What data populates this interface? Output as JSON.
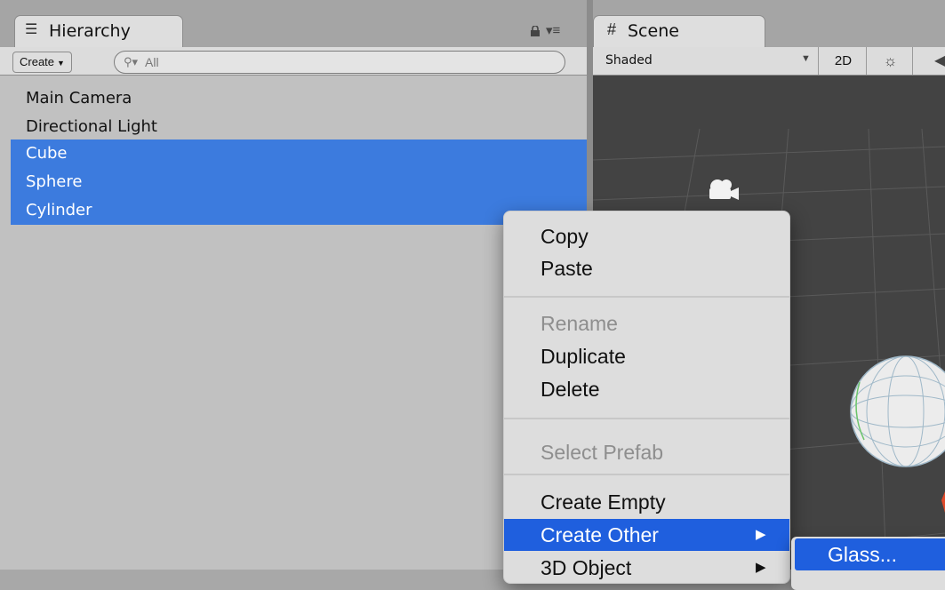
{
  "hierarchy": {
    "tab_label": "Hierarchy",
    "tab_icon": "list-icon",
    "lock_icon": "lock-icon",
    "menu_icon": "panel-menu-icon",
    "menu_glyph": "▾≡",
    "create_label": "Create",
    "search_placeholder": "All",
    "items": [
      {
        "label": "Main Camera",
        "selected": false
      },
      {
        "label": "Directional Light",
        "selected": false
      },
      {
        "label": "Cube",
        "selected": true
      },
      {
        "label": "Sphere",
        "selected": true
      },
      {
        "label": "Cylinder",
        "selected": true
      }
    ],
    "selection_color": "#3c7bde"
  },
  "scene": {
    "tab_label": "Scene",
    "tab_icon": "grid-icon",
    "shading_mode": "Shaded",
    "mode_2d_label": "2D",
    "lighting_icon": "sun-icon",
    "audio_icon": "speaker-icon",
    "background_color": "#434343"
  },
  "context_menu": {
    "items": [
      {
        "label": "Copy",
        "enabled": true
      },
      {
        "label": "Paste",
        "enabled": true
      },
      {
        "label": "Rename",
        "enabled": false
      },
      {
        "label": "Duplicate",
        "enabled": true
      },
      {
        "label": "Delete",
        "enabled": true
      },
      {
        "label": "Select Prefab",
        "enabled": false
      },
      {
        "label": "Create Empty",
        "enabled": true
      },
      {
        "label": "Create Other",
        "enabled": true,
        "submenu": true,
        "highlighted": true
      },
      {
        "label": "3D Object",
        "enabled": true,
        "submenu": true
      }
    ],
    "highlight_color": "#1f5fde"
  },
  "submenu": {
    "items": [
      {
        "label": "Glass...",
        "highlighted": true
      }
    ]
  }
}
